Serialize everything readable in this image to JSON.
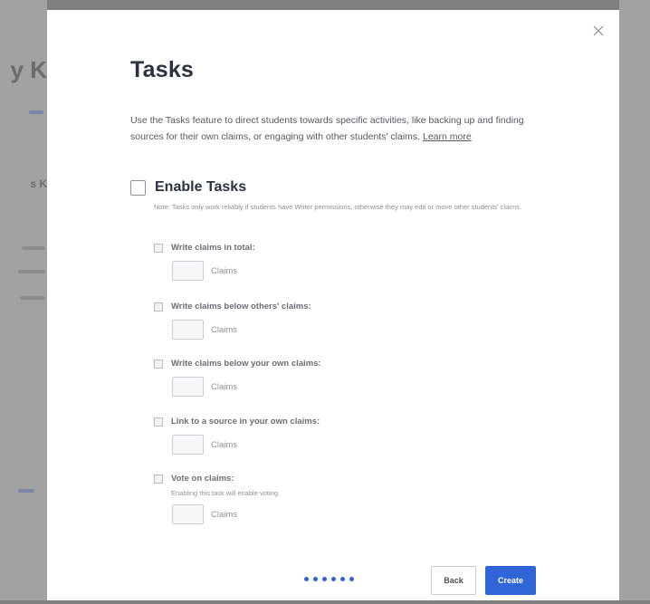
{
  "background": {
    "fragment_title": "y K",
    "fragment_heading": "s K"
  },
  "modal": {
    "title": "Tasks",
    "description": "Use the Tasks feature to direct students towards specific activities, like backing up and finding sources for their own claims, or engaging with other students' claims.",
    "learn_more": "Learn more",
    "enable_label": "Enable Tasks",
    "enable_checked": false,
    "note": "Note: Tasks only work reliably if students have Writer permissions, otherwise they may edit or move other students' claims.",
    "tasks": [
      {
        "label": "Write claims in total:",
        "sub": "",
        "value": "",
        "unit": "Claims"
      },
      {
        "label": "Write claims below others' claims:",
        "sub": "",
        "value": "",
        "unit": "Claims"
      },
      {
        "label": "Write claims below your own claims:",
        "sub": "",
        "value": "",
        "unit": "Claims"
      },
      {
        "label": "Link to a source in your own claims:",
        "sub": "",
        "value": "",
        "unit": "Claims"
      },
      {
        "label": "Vote on claims:",
        "sub": "Enabling this task will enable voting.",
        "value": "",
        "unit": "Claims"
      }
    ],
    "progress": {
      "steps": 6
    },
    "back_label": "Back",
    "create_label": "Create"
  },
  "colors": {
    "accent": "#2f65d6",
    "title": "#2b3240",
    "overlay": "#9a9a9a"
  },
  "icons": {
    "close": "close-icon"
  }
}
